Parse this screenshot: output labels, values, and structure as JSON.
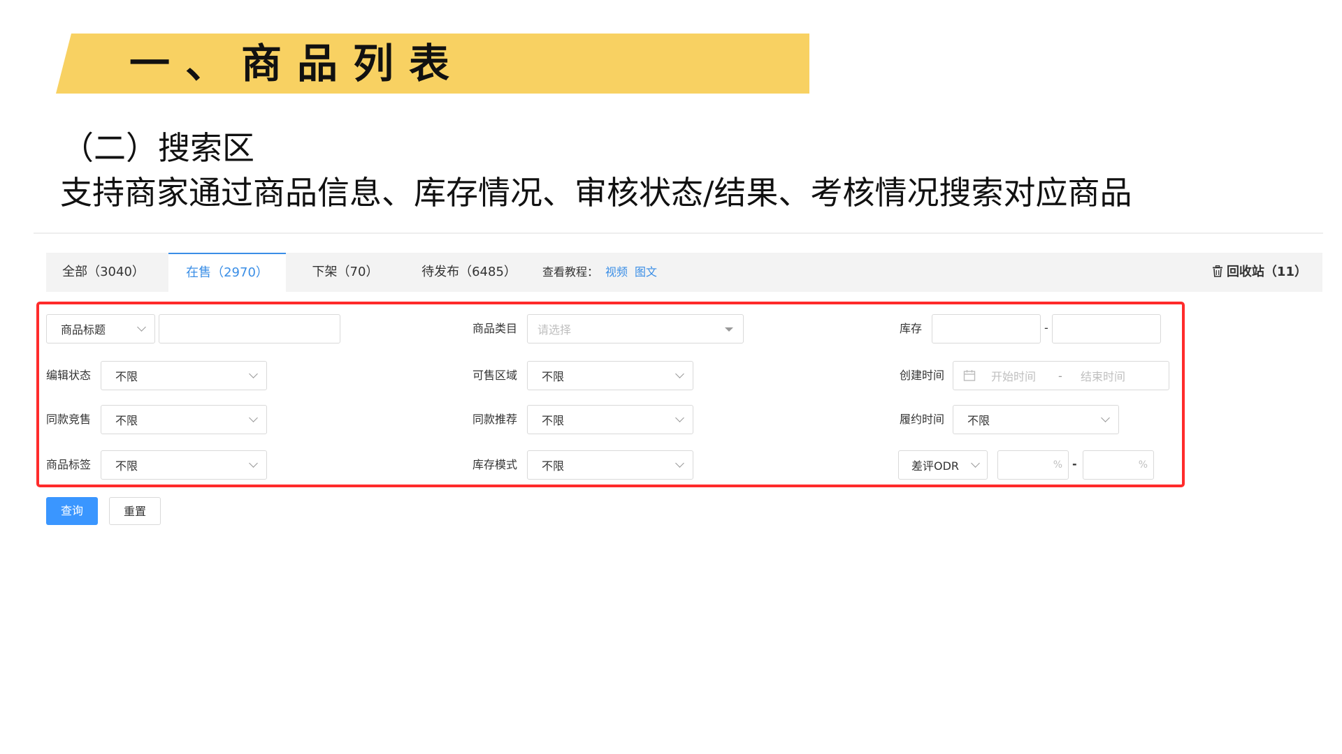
{
  "slide": {
    "title": "一、商品列表",
    "subtitle": "（二）搜索区",
    "description": "支持商家通过商品信息、库存情况、审核状态/结果、考核情况搜索对应商品"
  },
  "tabs": [
    {
      "label": "全部（3040）",
      "active": false
    },
    {
      "label": "在售（2970）",
      "active": true
    },
    {
      "label": "下架（70）",
      "active": false
    },
    {
      "label": "待发布（6485）",
      "active": false
    }
  ],
  "tutorial": {
    "label": "查看教程：",
    "links": [
      "视频",
      "图文"
    ]
  },
  "recycle_bin": {
    "label": "回收站（11）"
  },
  "filters": {
    "title_type": {
      "value": "商品标题",
      "input_value": ""
    },
    "category": {
      "label": "商品类目",
      "placeholder": "请选择"
    },
    "stock": {
      "label": "库存",
      "min": "",
      "max": "",
      "separator": "-"
    },
    "edit_status": {
      "label": "编辑状态",
      "value": "不限"
    },
    "sale_region": {
      "label": "可售区域",
      "value": "不限"
    },
    "created_time": {
      "label": "创建时间",
      "start_placeholder": "开始时间",
      "separator": "-",
      "end_placeholder": "结束时间"
    },
    "same_competition": {
      "label": "同款竞售",
      "value": "不限"
    },
    "same_recommend": {
      "label": "同款推荐",
      "value": "不限"
    },
    "fulfillment_time": {
      "label": "履约时间",
      "value": "不限"
    },
    "product_tag": {
      "label": "商品标签",
      "value": "不限"
    },
    "stock_mode": {
      "label": "库存模式",
      "value": "不限"
    },
    "metric": {
      "value": "差评ODR",
      "min": "",
      "max": "",
      "unit": "%",
      "separator": "-"
    }
  },
  "buttons": {
    "search": "查询",
    "reset": "重置"
  },
  "colors": {
    "accent": "#3a8ee6",
    "banner": "#f8d162",
    "highlight_frame": "#ff2b2b",
    "primary_button": "#3a96ff"
  }
}
